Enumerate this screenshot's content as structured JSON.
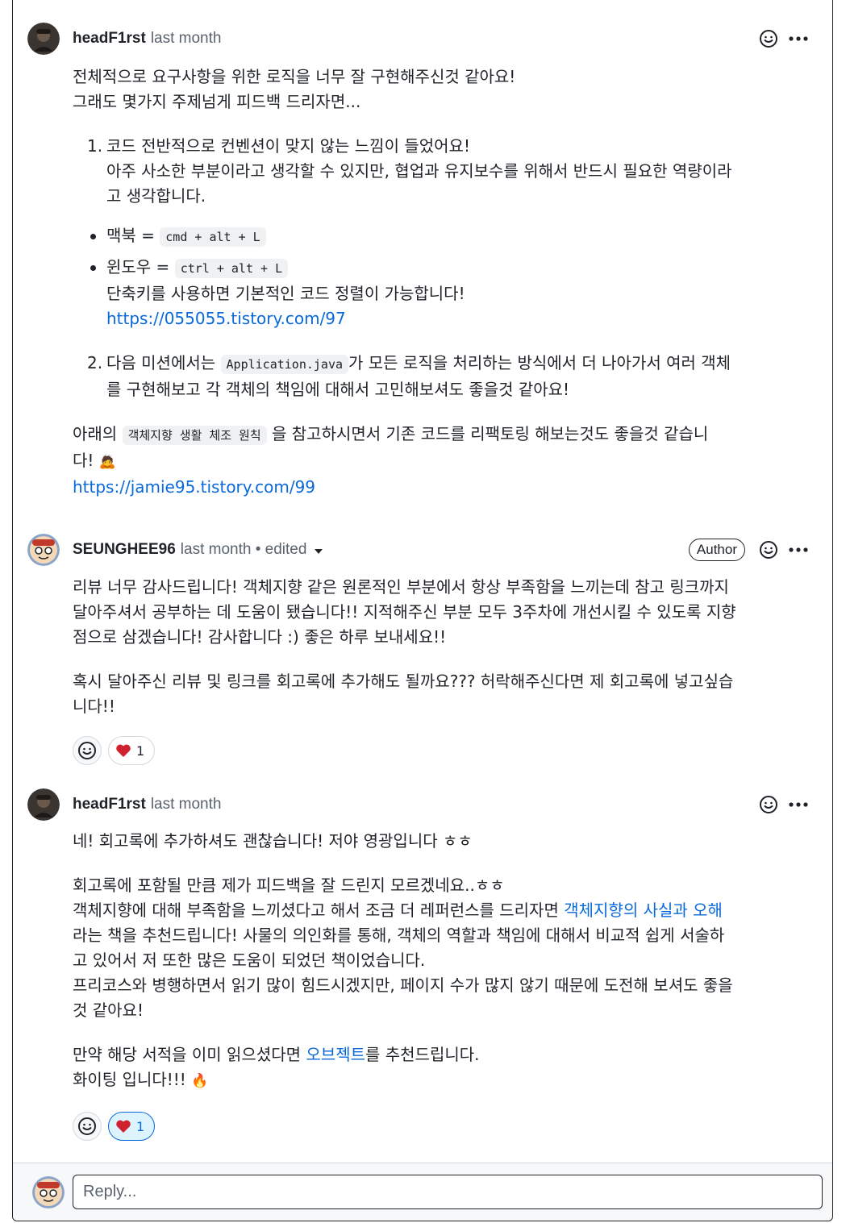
{
  "comments": [
    {
      "author": "headF1rst",
      "meta": "last month",
      "intro": [
        "전체적으로 요구사항을 위한 로직을 너무 잘 구현해주신것 같아요!",
        "그래도 몇가지 주제넘게 피드백 드리자면..."
      ],
      "item1": {
        "num": "1.",
        "line1": "코드 전반적으로 컨벤션이 맞지 않는 느낌이 들었어요!",
        "line2": "아주 사소한 부분이라고 생각할 수 있지만, 협업과 유지보수를 위해서 반드시 필요한 역량이라",
        "line3": "고 생각합니다."
      },
      "bullets": [
        {
          "label": "맥북 = ",
          "code": "cmd + alt + L"
        },
        {
          "label": "윈도우 = ",
          "code": "ctrl + alt + L"
        }
      ],
      "shortcut_note": "단축키를 사용하면 기본적인 코드 정렬이 가능합니다!",
      "link1": "https://055055.tistory.com/97",
      "item2": {
        "num": "2.",
        "pre": "다음 미션에서는 ",
        "code": "Application.java",
        "post": "가 모든 로직을 처리하는 방식에서 더 나아가서 여러 객체",
        "line2": "를 구현해보고 각 객체의 책임에 대해서 고민해보셔도 좋을것 같아요!"
      },
      "closing": {
        "pre": "아래의 ",
        "code": "객체지향 생활 체조 원칙",
        "post": " 을 참고하시면서 기존 코드를 리팩토링 해보는것도 좋을것 같습니",
        "line2": "다! ",
        "emoji": "🙇"
      },
      "link2": "https://jamie95.tistory.com/99"
    },
    {
      "author": "SEUNGHEE96",
      "meta": "last month • edited",
      "badge": "Author",
      "para1": [
        "리뷰 너무 감사드립니다! 객체지향 같은 원론적인 부분에서 항상 부족함을 느끼는데 참고 링크까지",
        "달아주셔서 공부하는 데 도움이 됐습니다!! 지적해주신 부분 모두 3주차에 개선시킬 수 있도록 지향",
        "점으로 삼겠습니다! 감사합니다 :) 좋은 하루 보내세요!!"
      ],
      "para2": [
        "혹시 달아주신 리뷰 및 링크를 회고록에 추가해도 될까요??? 허락해주신다면 제 회고록에 넣고싶습",
        "니다!!"
      ],
      "reaction_count": "1"
    },
    {
      "author": "headF1rst",
      "meta": "last month",
      "para1": "네! 회고록에 추가하셔도 괜찮습니다! 저야 영광입니다 ㅎㅎ",
      "para2_l1": "회고록에 포함될 만큼 제가 피드백을 잘 드린지 모르겠네요..ㅎㅎ",
      "para2_l2_pre": "객체지향에 대해 부족함을 느끼셨다고 해서 조금 더 레퍼런스를 드리자면 ",
      "para2_l2_link": "객체지향의 사실과 오해",
      "para2_rest": [
        "라는 책을 추천드립니다! 사물의 의인화를 통해, 객체의 역할과 책임에 대해서 비교적 쉽게 서술하",
        "고 있어서 저 또한 많은 도움이 되었던 책이었습니다.",
        "프리코스와 병행하면서 읽기 많이 힘드시겠지만, 페이지 수가 많지 않기 때문에 도전해 보셔도 좋을",
        "것 같아요!"
      ],
      "para3_pre": "만약 해당 서적을 이미 읽으셨다면 ",
      "para3_link": "오브젝트",
      "para3_post": "를 추천드립니다.",
      "para3_l2": "화이팅 입니다!!! ",
      "emoji": "🔥",
      "reaction_count": "1"
    }
  ],
  "reply": {
    "placeholder": "Reply..."
  },
  "colors": {
    "link": "#0969da",
    "muted": "#59636e",
    "heart": "#cf222e",
    "reaction_active_bg": "#ddf4ff"
  },
  "icons": [
    "smiley-icon",
    "kebab-icon",
    "heart-icon",
    "avatar"
  ]
}
